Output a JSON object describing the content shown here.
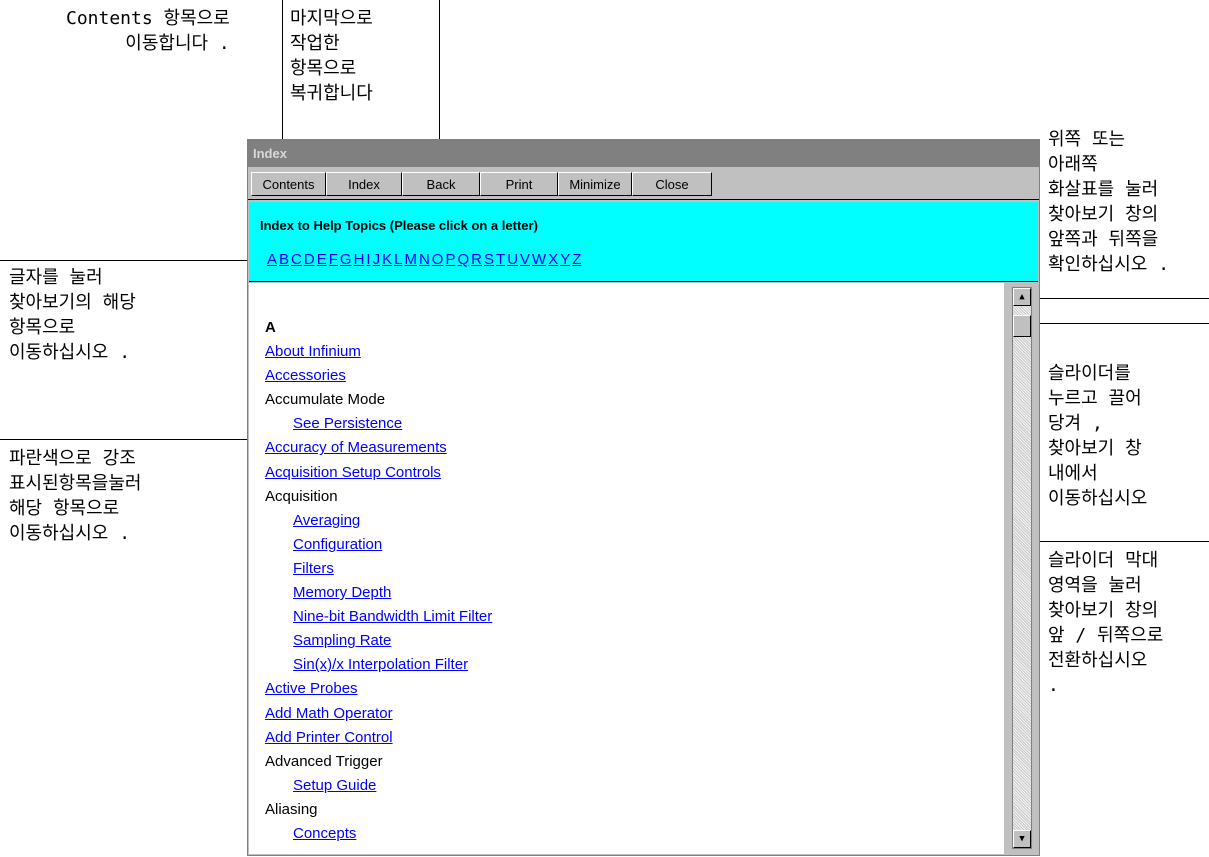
{
  "callouts": {
    "contents": "Contents 항목으로\n이동합니다 .",
    "back": "마지막으로\n작업한\n항목으로\n복귀합니다",
    "arrows": "위쪽 또는\n아래쪽\n화살표를 눌러\n찾아보기 창의\n앞쪽과 뒤쪽을\n확인하십시오 .",
    "letters": "글자를 눌러\n찾아보기의 해당\n항목으로\n이동하십시오 .",
    "slider": "슬라이더를\n누르고 끌어\n당겨 ,\n찾아보기 창\n내에서\n이동하십시오",
    "highlighted": "파란색으로 강조\n표시된항목을눌러\n해당 항목으로\n이동하십시오 .",
    "track": "슬라이더 막대\n영역을 눌러\n찾아보기 창의\n앞 / 뒤쪽으로\n전환하십시오\n."
  },
  "window": {
    "title": "Index",
    "toolbar": {
      "contents": "Contents",
      "index": "Index",
      "back": "Back",
      "print": "Print",
      "minimize": "Minimize",
      "close": "Close"
    },
    "heading": "Index to Help Topics  (Please click on a letter)",
    "letters": [
      "A",
      "B",
      "C",
      "D",
      "E",
      "F",
      "G",
      "H",
      "I",
      "J",
      "K",
      "L",
      "M",
      "N",
      "O",
      "P",
      "Q",
      "R",
      "S",
      "T",
      "U",
      "V",
      "W",
      "X",
      "Y",
      "Z"
    ],
    "link_color": "#0000ff",
    "panel_color": "#00ffff",
    "entries": [
      {
        "text": "A",
        "type": "section"
      },
      {
        "text": "About Infinium",
        "type": "link",
        "indent": 0
      },
      {
        "text": "Accessories",
        "type": "link",
        "indent": 0
      },
      {
        "text": "Accumulate Mode",
        "type": "plain",
        "indent": 0
      },
      {
        "text": "See Persistence",
        "type": "link",
        "indent": 1
      },
      {
        "text": "Accuracy of Measurements",
        "type": "link",
        "indent": 0
      },
      {
        "text": "Acquisition Setup Controls",
        "type": "link",
        "indent": 0
      },
      {
        "text": "Acquisition",
        "type": "plain",
        "indent": 0
      },
      {
        "text": "Averaging",
        "type": "link",
        "indent": 1
      },
      {
        "text": "Configuration",
        "type": "link",
        "indent": 1
      },
      {
        "text": "Filters",
        "type": "link",
        "indent": 1
      },
      {
        "text": "Memory Depth",
        "type": "link",
        "indent": 1
      },
      {
        "text": "Nine-bit Bandwidth Limit Filter",
        "type": "link",
        "indent": 1
      },
      {
        "text": "Sampling Rate",
        "type": "link",
        "indent": 1
      },
      {
        "text": "Sin(x)/x Interpolation Filter",
        "type": "link",
        "indent": 1
      },
      {
        "text": "Active Probes",
        "type": "link",
        "indent": 0
      },
      {
        "text": "Add Math Operator",
        "type": "link",
        "indent": 0
      },
      {
        "text": "Add Printer Control",
        "type": "link",
        "indent": 0
      },
      {
        "text": "Advanced Trigger",
        "type": "plain",
        "indent": 0
      },
      {
        "text": "Setup Guide",
        "type": "link",
        "indent": 1
      },
      {
        "text": "Aliasing",
        "type": "plain",
        "indent": 0
      },
      {
        "text": "Concepts",
        "type": "link",
        "indent": 1
      }
    ]
  }
}
